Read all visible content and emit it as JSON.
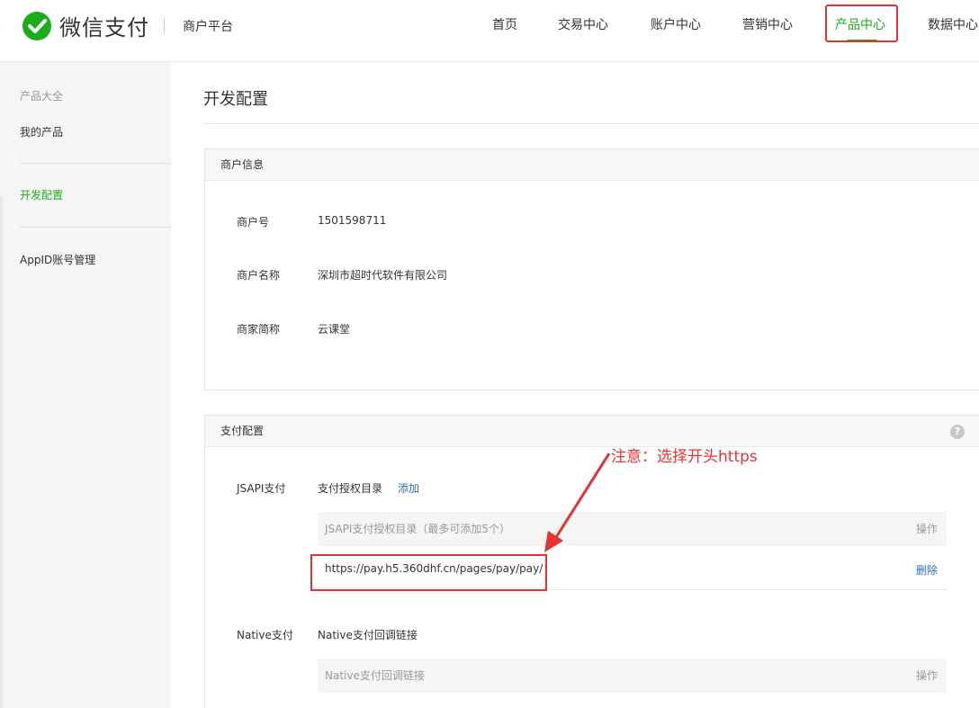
{
  "header": {
    "logo_text": "微信支付",
    "platform": "商户平台",
    "nav": [
      {
        "label": "首页"
      },
      {
        "label": "交易中心"
      },
      {
        "label": "账户中心"
      },
      {
        "label": "营销中心"
      },
      {
        "label": "产品中心",
        "active": true
      },
      {
        "label": "数据中心"
      }
    ]
  },
  "sidebar": {
    "group_label": "产品大全",
    "items": [
      {
        "label": "我的产品"
      },
      {
        "label": "开发配置",
        "active": true
      },
      {
        "label": "AppID账号管理"
      }
    ]
  },
  "page": {
    "title": "开发配置"
  },
  "merchant_info": {
    "heading": "商户信息",
    "rows": [
      {
        "label": "商户号",
        "value": "1501598711"
      },
      {
        "label": "商户名称",
        "value": "深圳市超时代软件有限公司"
      },
      {
        "label": "商家简称",
        "value": "云课堂"
      }
    ]
  },
  "payment_config": {
    "heading": "支付配置",
    "help_symbol": "?",
    "jsapi": {
      "label": "JSAPI支付",
      "dir_label": "支付授权目录",
      "add_link": "添加",
      "table_header": "JSAPI支付授权目录（最多可添加5个）",
      "ops_header": "操作",
      "rows": [
        {
          "url": "https://pay.h5.360dhf.cn/pages/pay/pay/",
          "action": "删除"
        }
      ]
    },
    "native": {
      "label": "Native支付",
      "callback_label": "Native支付回调链接",
      "table_header": "Native支付回调链接",
      "ops_header": "操作"
    }
  },
  "annotation": {
    "note": "注意：选择开头https",
    "color": "#e53333"
  },
  "colors": {
    "brand_green": "#1aad19",
    "link_blue": "#2f6ebd"
  }
}
